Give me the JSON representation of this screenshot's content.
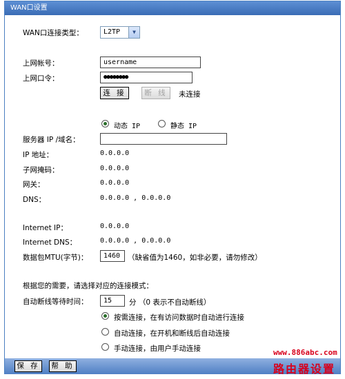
{
  "title": "WAN口设置",
  "wan_type": {
    "label": "WAN口连接类型：",
    "value": "L2TP"
  },
  "account": {
    "label": "上网帐号：",
    "value": "username"
  },
  "password": {
    "label": "上网口令：",
    "value": "●●●●●●●●"
  },
  "connect_button": "连 接",
  "disconnect_button": "断 线",
  "conn_status": "未连接",
  "ip_mode": {
    "dynamic": "动态 IP",
    "static": "静态 IP",
    "selected": "dynamic"
  },
  "server": {
    "label": "服务器 IP /域名：",
    "value": ""
  },
  "ip": {
    "label": "IP 地址：",
    "value": "0.0.0.0"
  },
  "mask": {
    "label": "子网掩码：",
    "value": "0.0.0.0"
  },
  "gateway": {
    "label": "网关：",
    "value": "0.0.0.0"
  },
  "dns": {
    "label": "DNS：",
    "value": "0.0.0.0 , 0.0.0.0"
  },
  "internet_ip": {
    "label": "Internet IP：",
    "value": "0.0.0.0"
  },
  "internet_dns": {
    "label": "Internet DNS：",
    "value": "0.0.0.0 , 0.0.0.0"
  },
  "mtu": {
    "label": "数据包MTU(字节)：",
    "value": "1460",
    "hint": "（缺省值为1460，如非必要，请勿修改）"
  },
  "mode_prompt": "根据您的需要，请选择对应的连接模式：",
  "idle": {
    "label": "自动断线等待时间：",
    "value": "15",
    "hint": "分 （0 表示不自动断线）"
  },
  "modes": [
    {
      "label": "按需连接，在有访问数据时自动进行连接",
      "selected": true
    },
    {
      "label": "自动连接，在开机和断线后自动连接",
      "selected": false
    },
    {
      "label": "手动连接，由用户手动连接",
      "selected": false
    }
  ],
  "save_button": "保 存",
  "help_button": "帮 助",
  "watermark": {
    "url": "www.886abc.com",
    "name": "路由器设置"
  },
  "colors": {
    "titlebar": "#3a6cb5",
    "watermark": "#d8001c"
  }
}
